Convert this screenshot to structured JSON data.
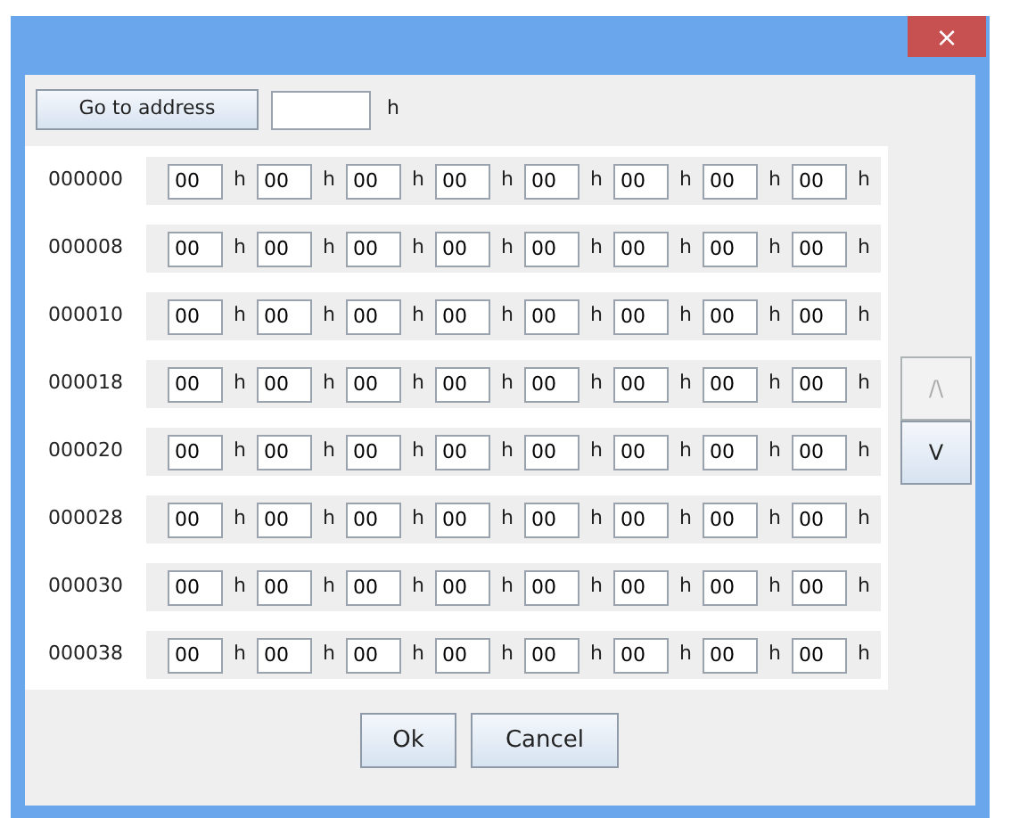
{
  "window": {
    "close": "×"
  },
  "goto": {
    "button": "Go to address",
    "suffix": "h"
  },
  "rows": [
    {
      "address": "000000",
      "bytes": [
        {
          "value": "00",
          "suffix": "h"
        },
        {
          "value": "00",
          "suffix": "h"
        },
        {
          "value": "00",
          "suffix": "h"
        },
        {
          "value": "00",
          "suffix": "h"
        },
        {
          "value": "00",
          "suffix": "h"
        },
        {
          "value": "00",
          "suffix": "h"
        },
        {
          "value": "00",
          "suffix": "h"
        },
        {
          "value": "00",
          "suffix": "h"
        }
      ]
    },
    {
      "address": "000008",
      "bytes": [
        {
          "value": "00",
          "suffix": "h"
        },
        {
          "value": "00",
          "suffix": "h"
        },
        {
          "value": "00",
          "suffix": "h"
        },
        {
          "value": "00",
          "suffix": "h"
        },
        {
          "value": "00",
          "suffix": "h"
        },
        {
          "value": "00",
          "suffix": "h"
        },
        {
          "value": "00",
          "suffix": "h"
        },
        {
          "value": "00",
          "suffix": "h"
        }
      ]
    },
    {
      "address": "000010",
      "bytes": [
        {
          "value": "00",
          "suffix": "h"
        },
        {
          "value": "00",
          "suffix": "h"
        },
        {
          "value": "00",
          "suffix": "h"
        },
        {
          "value": "00",
          "suffix": "h"
        },
        {
          "value": "00",
          "suffix": "h"
        },
        {
          "value": "00",
          "suffix": "h"
        },
        {
          "value": "00",
          "suffix": "h"
        },
        {
          "value": "00",
          "suffix": "h"
        }
      ]
    },
    {
      "address": "000018",
      "bytes": [
        {
          "value": "00",
          "suffix": "h"
        },
        {
          "value": "00",
          "suffix": "h"
        },
        {
          "value": "00",
          "suffix": "h"
        },
        {
          "value": "00",
          "suffix": "h"
        },
        {
          "value": "00",
          "suffix": "h"
        },
        {
          "value": "00",
          "suffix": "h"
        },
        {
          "value": "00",
          "suffix": "h"
        },
        {
          "value": "00",
          "suffix": "h"
        }
      ]
    },
    {
      "address": "000020",
      "bytes": [
        {
          "value": "00",
          "suffix": "h"
        },
        {
          "value": "00",
          "suffix": "h"
        },
        {
          "value": "00",
          "suffix": "h"
        },
        {
          "value": "00",
          "suffix": "h"
        },
        {
          "value": "00",
          "suffix": "h"
        },
        {
          "value": "00",
          "suffix": "h"
        },
        {
          "value": "00",
          "suffix": "h"
        },
        {
          "value": "00",
          "suffix": "h"
        }
      ]
    },
    {
      "address": "000028",
      "bytes": [
        {
          "value": "00",
          "suffix": "h"
        },
        {
          "value": "00",
          "suffix": "h"
        },
        {
          "value": "00",
          "suffix": "h"
        },
        {
          "value": "00",
          "suffix": "h"
        },
        {
          "value": "00",
          "suffix": "h"
        },
        {
          "value": "00",
          "suffix": "h"
        },
        {
          "value": "00",
          "suffix": "h"
        },
        {
          "value": "00",
          "suffix": "h"
        }
      ]
    },
    {
      "address": "000030",
      "bytes": [
        {
          "value": "00",
          "suffix": "h"
        },
        {
          "value": "00",
          "suffix": "h"
        },
        {
          "value": "00",
          "suffix": "h"
        },
        {
          "value": "00",
          "suffix": "h"
        },
        {
          "value": "00",
          "suffix": "h"
        },
        {
          "value": "00",
          "suffix": "h"
        },
        {
          "value": "00",
          "suffix": "h"
        },
        {
          "value": "00",
          "suffix": "h"
        }
      ]
    },
    {
      "address": "000038",
      "bytes": [
        {
          "value": "00",
          "suffix": "h"
        },
        {
          "value": "00",
          "suffix": "h"
        },
        {
          "value": "00",
          "suffix": "h"
        },
        {
          "value": "00",
          "suffix": "h"
        },
        {
          "value": "00",
          "suffix": "h"
        },
        {
          "value": "00",
          "suffix": "h"
        },
        {
          "value": "00",
          "suffix": "h"
        },
        {
          "value": "00",
          "suffix": "h"
        }
      ]
    }
  ],
  "scroll": [
    {
      "label": "/\\",
      "disabled": true
    },
    {
      "label": "V",
      "disabled": false
    }
  ],
  "buttons": [
    "Ok",
    "Cancel"
  ]
}
